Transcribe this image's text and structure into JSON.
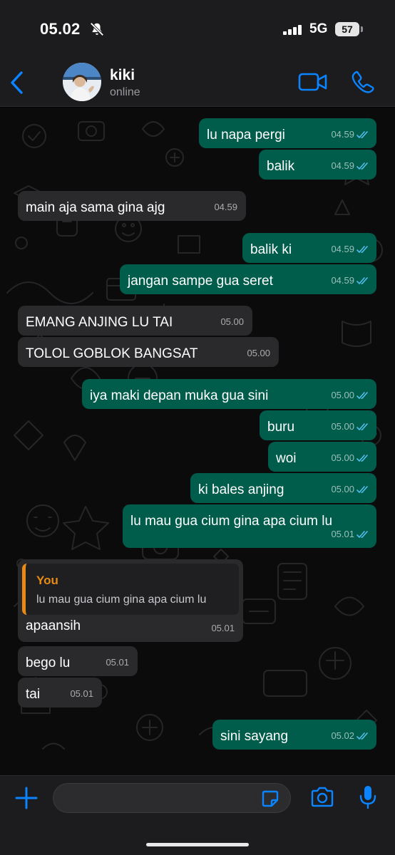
{
  "status_bar": {
    "time": "05.02",
    "network": "5G",
    "battery": "57"
  },
  "header": {
    "back_icon": "chevron-left-icon",
    "contact_name": "kiki",
    "contact_status": "online",
    "video_icon": "video-camera-icon",
    "call_icon": "phone-icon"
  },
  "messages": [
    {
      "direction": "out",
      "text": "lu napa pergi",
      "time": "04.59",
      "status": "read"
    },
    {
      "direction": "out",
      "text": "balik",
      "time": "04.59",
      "status": "read"
    },
    {
      "direction": "in",
      "text": "main aja sama gina ajg",
      "time": "04.59"
    },
    {
      "direction": "out",
      "text": "balik ki",
      "time": "04.59",
      "status": "read"
    },
    {
      "direction": "out",
      "text": "jangan sampe gua seret",
      "time": "04.59",
      "status": "read"
    },
    {
      "direction": "in",
      "text": "EMANG ANJING LU TAI",
      "time": "05.00"
    },
    {
      "direction": "in",
      "text": "TOLOL GOBLOK BANGSAT",
      "time": "05.00"
    },
    {
      "direction": "out",
      "text": "iya maki depan muka gua sini",
      "time": "05.00",
      "status": "read"
    },
    {
      "direction": "out",
      "text": "buru",
      "time": "05.00",
      "status": "read"
    },
    {
      "direction": "out",
      "text": "woi",
      "time": "05.00",
      "status": "read"
    },
    {
      "direction": "out",
      "text": "ki bales anjing",
      "time": "05.00",
      "status": "read"
    },
    {
      "direction": "out",
      "text": "lu mau gua cium gina apa cium lu",
      "time": "05.01",
      "status": "read"
    },
    {
      "direction": "in",
      "text": "apaansih",
      "time": "05.01",
      "quote": {
        "author": "You",
        "text": "lu mau gua cium gina apa cium lu"
      }
    },
    {
      "direction": "in",
      "text": "bego lu",
      "time": "05.01"
    },
    {
      "direction": "in",
      "text": "tai",
      "time": "05.01"
    },
    {
      "direction": "out",
      "text": "sini sayang",
      "time": "05.02",
      "status": "read"
    }
  ],
  "input_bar": {
    "placeholder": "",
    "plus_icon": "plus-icon",
    "sticker_icon": "sticker-icon",
    "camera_icon": "camera-icon",
    "mic_icon": "microphone-icon"
  },
  "colors": {
    "accent": "#0a84ff",
    "outgoing_bubble": "#005c4b",
    "incoming_bubble": "#2a2a2c",
    "read_ticks": "#53bdeb",
    "quote_accent": "#e88a14"
  }
}
